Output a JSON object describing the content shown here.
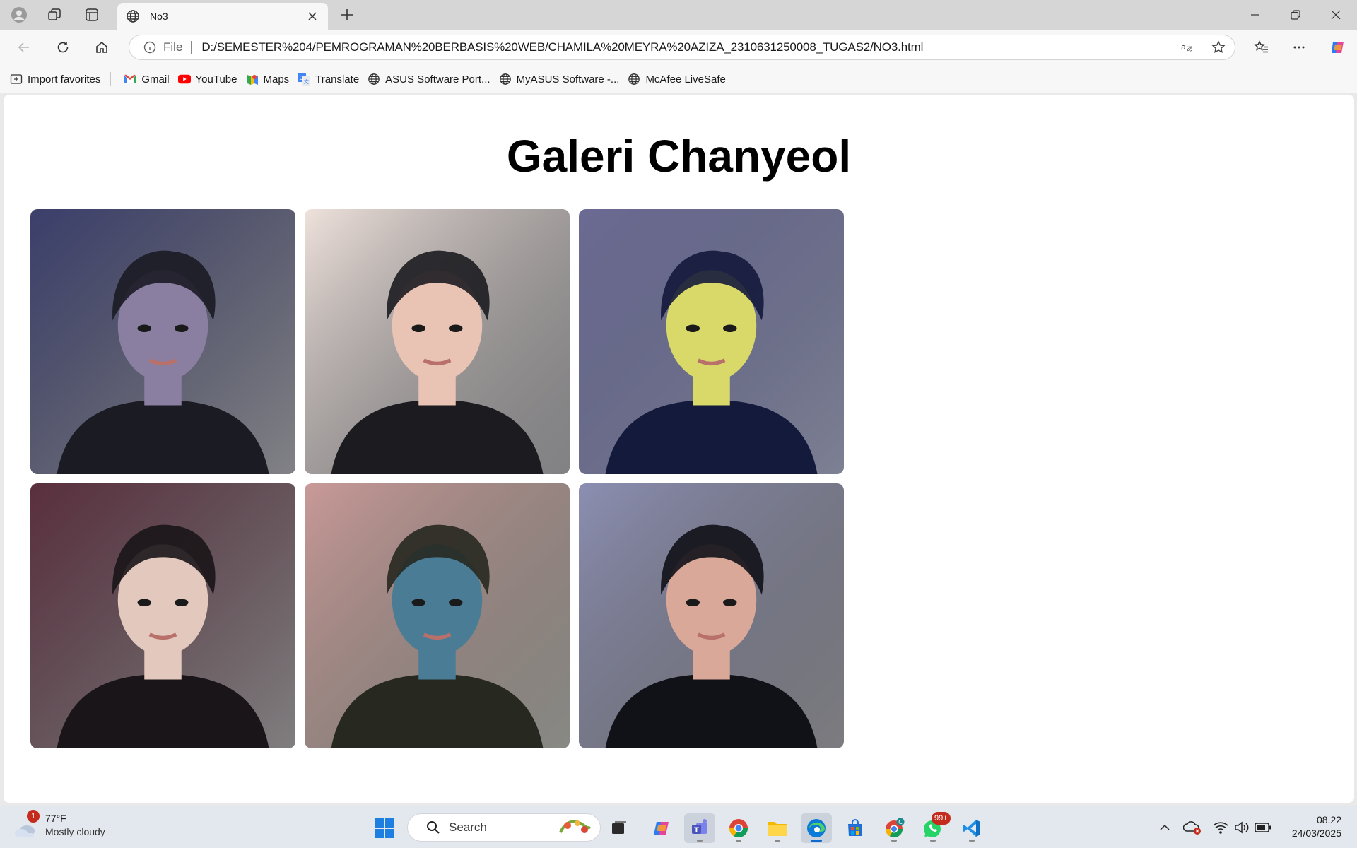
{
  "browser": {
    "tab": {
      "title": "No3"
    },
    "address": {
      "scheme_label": "File",
      "url": "D:/SEMESTER%204/PEMROGRAMAN%20BERBASIS%20WEB/CHAMILA%20MEYRA%20AZIZA_2310631250008_TUGAS2/NO3.html"
    },
    "favorites": [
      {
        "label": "Import favorites",
        "icon": "import-icon"
      },
      {
        "label": "Gmail",
        "icon": "gmail-icon"
      },
      {
        "label": "YouTube",
        "icon": "youtube-icon"
      },
      {
        "label": "Maps",
        "icon": "maps-icon"
      },
      {
        "label": "Translate",
        "icon": "translate-icon"
      },
      {
        "label": "ASUS Software Port...",
        "icon": "globe-icon"
      },
      {
        "label": "MyASUS Software -...",
        "icon": "globe-icon"
      },
      {
        "label": "McAfee LiveSafe",
        "icon": "globe-icon"
      }
    ]
  },
  "page": {
    "heading": "Galeri Chanyeol",
    "photos": [
      {
        "tone": "night-city",
        "colors": [
          "#3b3f6b",
          "#8a7fa0",
          "#1b1b24"
        ]
      },
      {
        "tone": "light-pink",
        "colors": [
          "#efe2dc",
          "#e9c3b4",
          "#1c1c20"
        ]
      },
      {
        "tone": "navy-yellow",
        "colors": [
          "#6b6a93",
          "#d9d96a",
          "#141a3c"
        ]
      },
      {
        "tone": "maroon",
        "colors": [
          "#5a2f3e",
          "#e3c8bd",
          "#1a1518"
        ]
      },
      {
        "tone": "pink-sky",
        "colors": [
          "#c99a98",
          "#4a7d95",
          "#272820"
        ]
      },
      {
        "tone": "lavender",
        "colors": [
          "#8c8fb2",
          "#d9a898",
          "#111118"
        ]
      }
    ]
  },
  "taskbar": {
    "weather": {
      "temp": "77°F",
      "desc": "Mostly cloudy",
      "badge": "1"
    },
    "search_label": "Search",
    "whatsapp_badge": "99+",
    "clock": {
      "time": "08.22",
      "date": "24/03/2025"
    }
  }
}
